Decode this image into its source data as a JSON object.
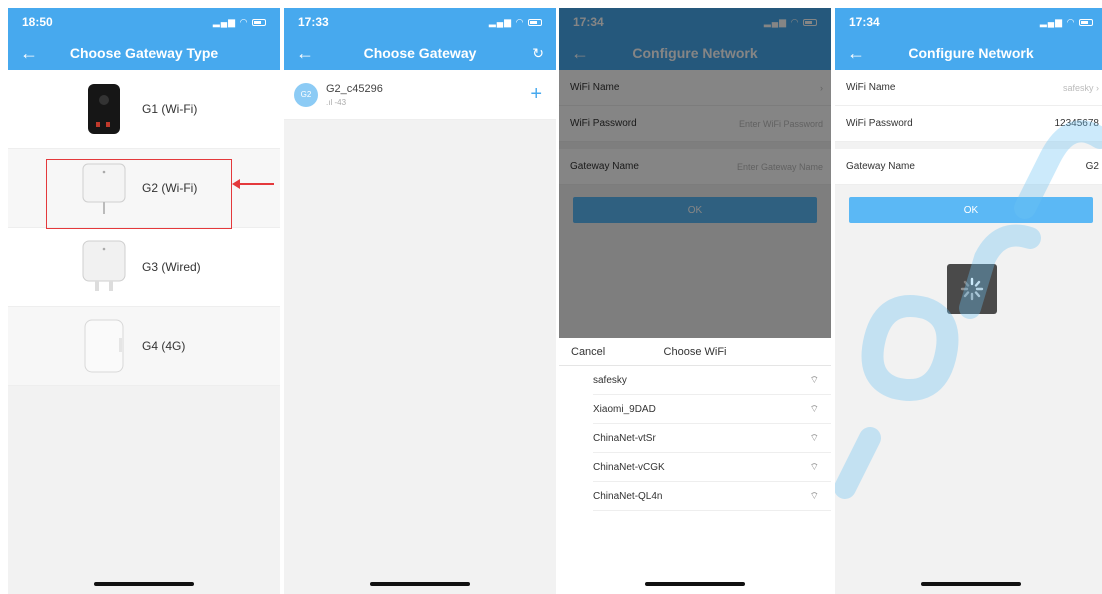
{
  "colors": {
    "accent": "#47a9ee",
    "highlight": "#e4393c"
  },
  "screen1": {
    "time": "18:50",
    "title": "Choose Gateway Type",
    "gateways": [
      {
        "label": "G1 (Wi-Fi)",
        "icon": "g1-gateway-icon"
      },
      {
        "label": "G2 (Wi-Fi)",
        "icon": "g2-gateway-icon"
      },
      {
        "label": "G3 (Wired)",
        "icon": "g3-gateway-icon"
      },
      {
        "label": "G4 (4G)",
        "icon": "g4-gateway-icon"
      }
    ]
  },
  "screen2": {
    "time": "17:33",
    "title": "Choose Gateway",
    "device": {
      "badge": "G2",
      "name": "G2_c45296",
      "signal": "-43"
    }
  },
  "screen3": {
    "time": "17:34",
    "title": "Configure Network",
    "wifi_name_label": "WiFi Name",
    "wifi_password_label": "WiFi Password",
    "wifi_password_placeholder": "Enter WiFi Password",
    "gateway_name_label": "Gateway Name",
    "gateway_name_placeholder": "Enter Gateway Name",
    "ok_label": "OK",
    "sheet": {
      "cancel_label": "Cancel",
      "title": "Choose WiFi",
      "networks": [
        "safesky",
        "Xiaomi_9DAD",
        "ChinaNet-vtSr",
        "ChinaNet-vCGK",
        "ChinaNet-QL4n"
      ]
    }
  },
  "screen4": {
    "time": "17:34",
    "title": "Configure Network",
    "wifi_name_label": "WiFi Name",
    "wifi_name_value": "safesky",
    "wifi_password_label": "WiFi Password",
    "wifi_password_value": "12345678",
    "gateway_name_label": "Gateway Name",
    "gateway_name_value": "G2",
    "ok_label": "OK"
  }
}
